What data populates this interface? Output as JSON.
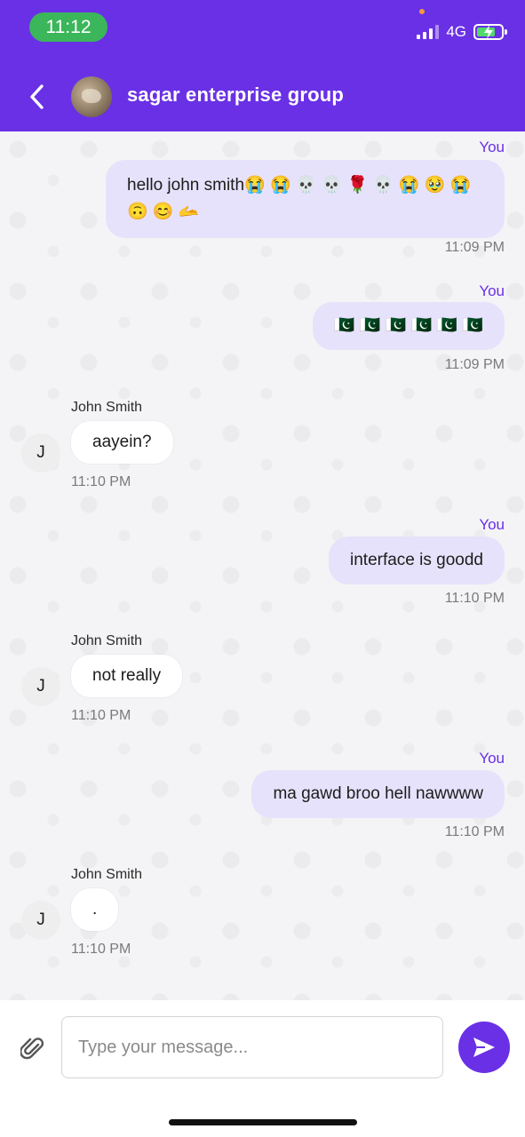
{
  "status_bar": {
    "time": "11:12",
    "network": "4G",
    "icons": [
      "signal-icon",
      "battery-charging-icon"
    ]
  },
  "header": {
    "back_icon": "chevron-left-icon",
    "title": "sagar enterprise group"
  },
  "messages": [
    {
      "direction": "out",
      "label": "You",
      "text": "hello john smith😭 😭 💀 💀 🌹 💀 😭 🥹 😭 🙃 😊 🫴",
      "time": "11:09 PM"
    },
    {
      "direction": "out",
      "label": "You",
      "text": "🇵🇰 🇵🇰 🇵🇰 🇵🇰 🇵🇰 🇵🇰",
      "time": "11:09 PM"
    },
    {
      "direction": "in",
      "sender": "John Smith",
      "initial": "J",
      "text": "aayein?",
      "time": "11:10 PM"
    },
    {
      "direction": "out",
      "label": "You",
      "text": "interface is goodd",
      "time": "11:10 PM"
    },
    {
      "direction": "in",
      "sender": "John Smith",
      "initial": "J",
      "text": "not really",
      "time": "11:10 PM"
    },
    {
      "direction": "out",
      "label": "You",
      "text": "ma gawd broo hell nawwww",
      "time": "11:10 PM"
    },
    {
      "direction": "in",
      "sender": "John Smith",
      "initial": "J",
      "text": ".",
      "time": "11:10 PM"
    }
  ],
  "composer": {
    "placeholder": "Type your message...",
    "value": "",
    "attach_icon": "paperclip-icon",
    "send_icon": "send-icon"
  },
  "colors": {
    "brand": "#6a30e6",
    "outgoing_bubble": "#e7e2fb",
    "incoming_bubble": "#ffffff",
    "time_pill": "#3bb65a"
  }
}
